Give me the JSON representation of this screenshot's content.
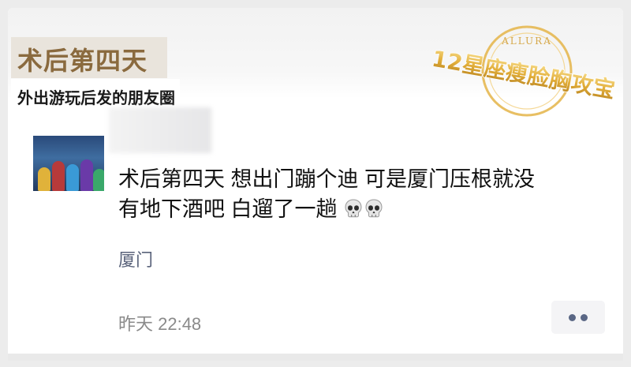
{
  "banner": {
    "title": "术后第四天",
    "caption": "外出游玩后发的朋友圈"
  },
  "watermark": {
    "top_text": "ALLURA",
    "main_text": "12星座瘦脸胸攻宝",
    "colors": {
      "gold": "#d8a630",
      "gold_light": "#f4d27a"
    }
  },
  "post": {
    "avatar": "avatar-image",
    "text_line1": "术后第四天 想出门蹦个迪  可是厦门压根就没",
    "text_line2": "有地下酒吧 白遛了一趟",
    "emoji": [
      "skull-emoji",
      "skull-emoji"
    ],
    "location": "厦门",
    "time": "昨天 22:48",
    "more_icon": "more-dots-icon"
  },
  "colors": {
    "title": "#8a6a3e",
    "link": "#59627a",
    "time": "#8a8a8a"
  }
}
